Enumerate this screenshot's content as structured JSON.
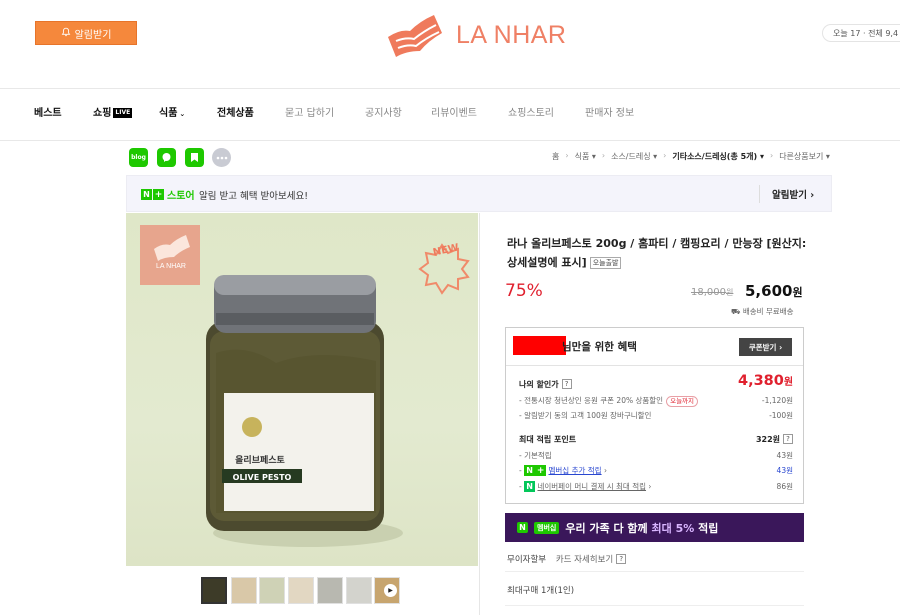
{
  "header": {
    "alarm_label": "알림받기",
    "brand_name": "LA NHAR",
    "visitors_text": "오늘 17 · 전체 9,4"
  },
  "nav": {
    "items": [
      "베스트",
      "쇼핑",
      "식품",
      "전체상품",
      "묻고 답하기",
      "공지사항",
      "리뷰이벤트",
      "쇼핑스토리",
      "판매자 정보"
    ],
    "live_badge": "LIVE"
  },
  "share": {
    "blog_label": "blog"
  },
  "breadcrumb": [
    "홈",
    "식품",
    "소스/드레싱",
    "기타소스/드레싱(총 5개)",
    "다른상품보기"
  ],
  "store_banner": {
    "logo_text": "스토어",
    "text": "알림 받고 혜택 받아보세요!",
    "alarm_label": "알림받기"
  },
  "product": {
    "photo_brand": "LA NHAR",
    "new_badge": "NEW",
    "label_text_kr": "올리브페스토",
    "label_text_en": "OLIVE PESTO",
    "title": "라나 올리브페스토 200g / 홈파티 / 캠핑요리 / 만능장 [원산지:상세설명에 표시]",
    "today_badge": "오늘출발",
    "discount": "75%",
    "original_price": "18,000",
    "original_price_unit": "원",
    "sale_price": "5,600",
    "sale_price_unit": "원",
    "shipping": "배송비 무료배송"
  },
  "benefit": {
    "title": "님만을 위한 혜택",
    "coupon_label": "쿠폰받기",
    "my_discount_label": "나의 할인가",
    "my_price": "4,380",
    "my_price_unit": "원",
    "discount_rows": [
      {
        "label": "전통시장 청년상인 응원 쿠폰 20% 상품할인",
        "tag": "오늘까지",
        "value": "-1,120원"
      },
      {
        "label": "알림받기 동의 고객 100원 장바구니할인",
        "value": "-100원"
      }
    ],
    "points_label": "최대 적립 포인트",
    "points_total": "322원",
    "points_rows": [
      {
        "label": "기본적립",
        "value": "43원"
      },
      {
        "label": "멤버십 추가 적립",
        "value": "43원"
      },
      {
        "label": "네이버페이 머니 결제 시 최대 적립",
        "value": "86원"
      }
    ]
  },
  "family_banner": {
    "pay_label": "멤버십",
    "text_prefix": "우리 가족 다 함께",
    "highlight": "최대 5%",
    "text_suffix": "적립"
  },
  "purchase": {
    "installment": "무이자할부",
    "card_detail": "카드 자세히보기",
    "max_buy": "최대구매 1개(1인)"
  },
  "colors": {
    "accent_orange": "#f5883c",
    "brand_salmon": "#ef8065",
    "sale_red": "#e0202e",
    "naver_green": "#1ec800",
    "family_purple": "#3a175a"
  }
}
